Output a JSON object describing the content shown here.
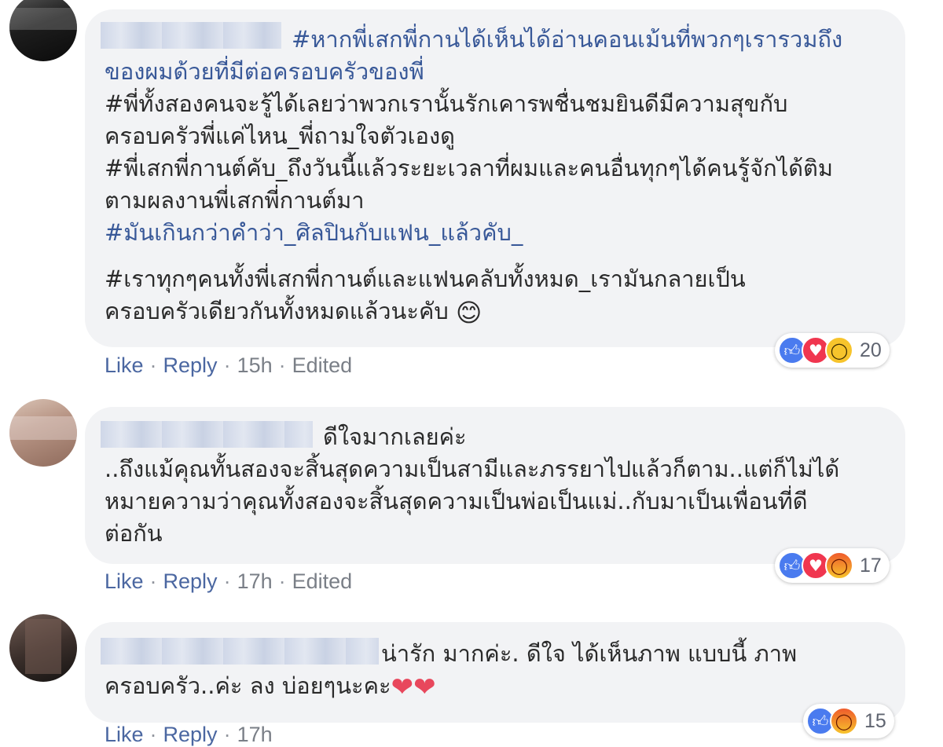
{
  "comments": [
    {
      "lines": [
        {
          "tag": "#หากพี่เสกพี่กานได้เห็นได้อ่านคอนเม้นที่พวกๆเรารวมถึง",
          "text": ""
        },
        {
          "tag": "ของผมด้วยที่มีต่อครอบครัวของพี่",
          "text": ""
        },
        {
          "tag": "",
          "text": "#พี่ทั้งสองคนจะรู้ได้เลยว่าพวกเรานั้นรักเคารพชื่นชมยินดีมีความสุขกับ"
        },
        {
          "tag": "",
          "text": "ครอบครัวพี่แค่ไหน_พี่ถามใจตัวเองดู"
        },
        {
          "tag": "",
          "text": "#พี่เสกพี่กานต์คับ_ถึงวันนี้แล้วระยะเวลาที่ผมและคนอื่นทุกๆได้คนรู้จักได้ติม"
        },
        {
          "tag": "",
          "text": "ตามผลงานพี่เสกพี่กานต์มา"
        },
        {
          "tag": "#มันเกินกว่าคำว่า_ศิลปินกับแฟน_แล้วคับ_",
          "text": ""
        },
        {
          "tag": "",
          "text": "#เราทุกๆคนทั้งพี่เสกพี่กานต์และแฟนคลับทั้งหมด_เรามันกลายเป็น"
        },
        {
          "tag": "",
          "text": "ครอบครัวเดียวกันทั้งหมดแล้วนะคับ"
        }
      ],
      "emoji": "😊",
      "like": "Like",
      "reply": "Reply",
      "time": "15h",
      "edited": "Edited",
      "reactions": [
        "like-icon",
        "love-icon",
        "wow-icon"
      ],
      "reaction_count": "20"
    },
    {
      "name_suffix": "ดีใจมากเลยค่ะ",
      "lines": [
        {
          "text": "..ถึงแม้คุณทั้นสองจะสิ้นสุดความเป็นสามีและภรรยาไปแล้วก็ตาม..แต่ก็ไม่ได้"
        },
        {
          "text": "หมายความว่าคุณทั้งสองจะสิ้นสุดความเป็นพ่อเป็นแม่..กับมาเป็นเพื่อนที่ดี"
        },
        {
          "text": "ต่อกัน"
        }
      ],
      "like": "Like",
      "reply": "Reply",
      "time": "17h",
      "edited": "Edited",
      "reactions": [
        "like-icon",
        "love-icon",
        "angry-icon"
      ],
      "reaction_count": "17"
    },
    {
      "name_suffix": "น่ารัก มากค่ะ. ดีใจ ได้เห็นภาพ แบบนี้ ภาพ",
      "lines": [
        {
          "text": "ครอบครัว..ค่ะ ลง บ่อยๆนะคะ"
        }
      ],
      "hearts": "❤❤",
      "like": "Like",
      "reply": "Reply",
      "time": "17h",
      "reactions": [
        "like-icon",
        "angry-icon"
      ],
      "reaction_count": "15"
    }
  ],
  "colors": {
    "bubble": "#f2f3f5",
    "link": "#4b67a1",
    "hashtag": "#385898",
    "like": "#4a7bef",
    "love": "#f0364f",
    "wow": "#f7c42c"
  }
}
